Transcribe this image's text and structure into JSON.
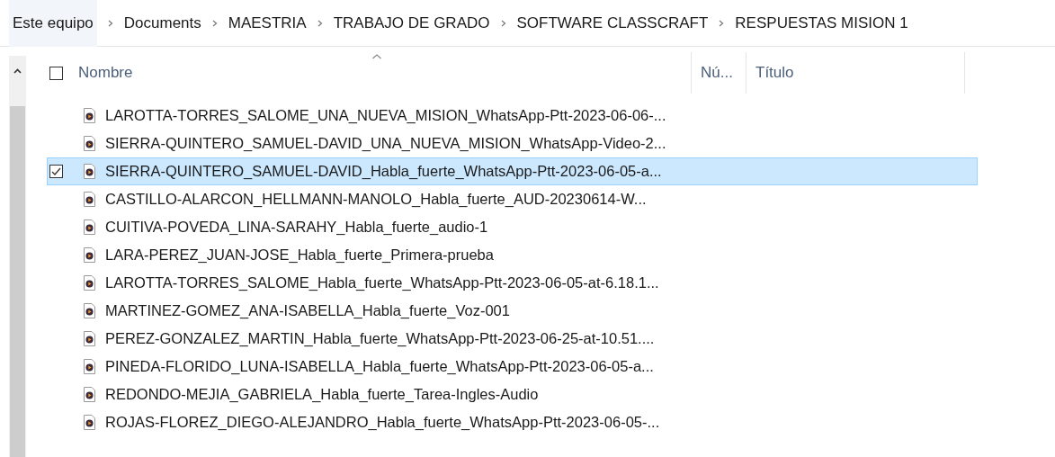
{
  "breadcrumb": [
    "Este equipo",
    "Documents",
    "MAESTRIA",
    "TRABAJO DE GRADO",
    "SOFTWARE CLASSCRAFT",
    "RESPUESTAS MISION 1"
  ],
  "columns": [
    {
      "label": "Nombre",
      "sorted": true
    },
    {
      "label": "Nú...",
      "sorted": false
    },
    {
      "label": "Título",
      "sorted": false
    }
  ],
  "select_all": {
    "checked": false
  },
  "files": [
    {
      "name": "LAROTTA-TORRES_SALOME_UNA_NUEVA_MISION_WhatsApp-Ptt-2023-06-06-...",
      "selected": false
    },
    {
      "name": "SIERRA-QUINTERO_SAMUEL-DAVID_UNA_NUEVA_MISION_WhatsApp-Video-2...",
      "selected": false
    },
    {
      "name": "SIERRA-QUINTERO_SAMUEL-DAVID_Habla_fuerte_WhatsApp-Ptt-2023-06-05-a...",
      "selected": true
    },
    {
      "name": "CASTILLO-ALARCON_HELLMANN-MANOLO_Habla_fuerte_AUD-20230614-W...",
      "selected": false
    },
    {
      "name": "CUITIVA-POVEDA_LINA-SARAHY_Habla_fuerte_audio-1",
      "selected": false
    },
    {
      "name": "LARA-PEREZ_JUAN-JOSE_Habla_fuerte_Primera-prueba",
      "selected": false
    },
    {
      "name": "LAROTTA-TORRES_SALOME_Habla_fuerte_WhatsApp-Ptt-2023-06-05-at-6.18.1...",
      "selected": false
    },
    {
      "name": "MARTINEZ-GOMEZ_ANA-ISABELLA_Habla_fuerte_Voz-001",
      "selected": false
    },
    {
      "name": "PEREZ-GONZALEZ_MARTIN_Habla_fuerte_WhatsApp-Ptt-2023-06-25-at-10.51....",
      "selected": false
    },
    {
      "name": "PINEDA-FLORIDO_LUNA-ISABELLA_Habla_fuerte_WhatsApp-Ptt-2023-06-05-a...",
      "selected": false
    },
    {
      "name": "REDONDO-MEJIA_GABRIELA_Habla_fuerte_Tarea-Ingles-Audio",
      "selected": false
    },
    {
      "name": "ROJAS-FLOREZ_DIEGO-ALEJANDRO_Habla_fuerte_WhatsApp-Ptt-2023-06-05-...",
      "selected": false
    }
  ]
}
